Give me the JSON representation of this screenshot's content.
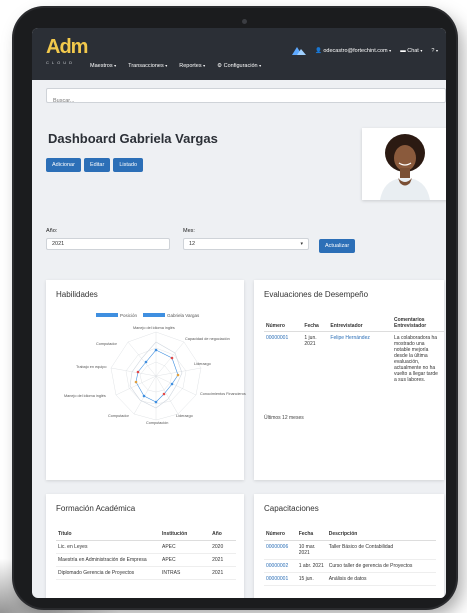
{
  "app": {
    "logo": "Adm",
    "logo_sub": "CLOUD"
  },
  "nav": {
    "menu": [
      "Maestros",
      "Transacciones",
      "Reportes",
      "Configuración"
    ],
    "user": "odecastro@fortechint.com",
    "chat": "Chat"
  },
  "search": {
    "placeholder": "Buscar..."
  },
  "page": {
    "title": "Dashboard Gabriela Vargas",
    "actions": [
      "Adicionar",
      "Editar",
      "Listado"
    ]
  },
  "filters": {
    "year_label": "Año:",
    "year_value": "2021",
    "month_label": "Mes:",
    "month_value": "12",
    "update_label": "Actualizar"
  },
  "skills": {
    "title": "Habilidades",
    "legend": [
      "Posición",
      "Gabriela Vargas"
    ],
    "axes": [
      "Manejo del idioma inglés",
      "Capacidad de negociación",
      "Liderazgo",
      "Conocimientos Financieros",
      "Liderazgo",
      "Computación",
      "Computador",
      "Manejo del idioma inglés",
      "Trabajo en equipo",
      "Computador"
    ],
    "colors": {
      "position": "#3f8fe0",
      "person": "#cfd6de"
    }
  },
  "evaluations": {
    "title": "Evaluaciones de Desempeño",
    "headers": [
      "Número",
      "Fecha",
      "Entrevistador",
      "Comentarios Entrevistador"
    ],
    "rows": [
      {
        "number": "00000001",
        "date": "1 jun. 2021",
        "interviewer": "Felipe Hernández",
        "comment": "La colaboradora ha mostrado una notable mejoría desde la última evaluación, actualmente no ha vuelto a llegar tarde a sus labores."
      }
    ],
    "footnote": "Últimos 12 meses"
  },
  "education": {
    "title": "Formación Académica",
    "headers": [
      "Título",
      "Institución",
      "Año"
    ],
    "rows": [
      {
        "title": "Lic. en Leyes",
        "institution": "APEC",
        "year": "2020"
      },
      {
        "title": "Maestría en Administración de Empresa",
        "institution": "APEC",
        "year": "2021"
      },
      {
        "title": "Diplomado Gerencia de Proyectos",
        "institution": "INTRAS",
        "year": "2021"
      }
    ]
  },
  "trainings": {
    "title": "Capacitaciones",
    "headers": [
      "Número",
      "Fecha",
      "Descripción"
    ],
    "rows": [
      {
        "number": "00000006",
        "date": "10 mar. 2021",
        "description": "Taller Básico de Contabilidad"
      },
      {
        "number": "00000002",
        "date": "1 abr. 2021",
        "description": "Curso taller de gerencia de Proyectos"
      },
      {
        "number": "00000001",
        "date": "15 jun.",
        "description": "Análisis de datos"
      }
    ]
  }
}
